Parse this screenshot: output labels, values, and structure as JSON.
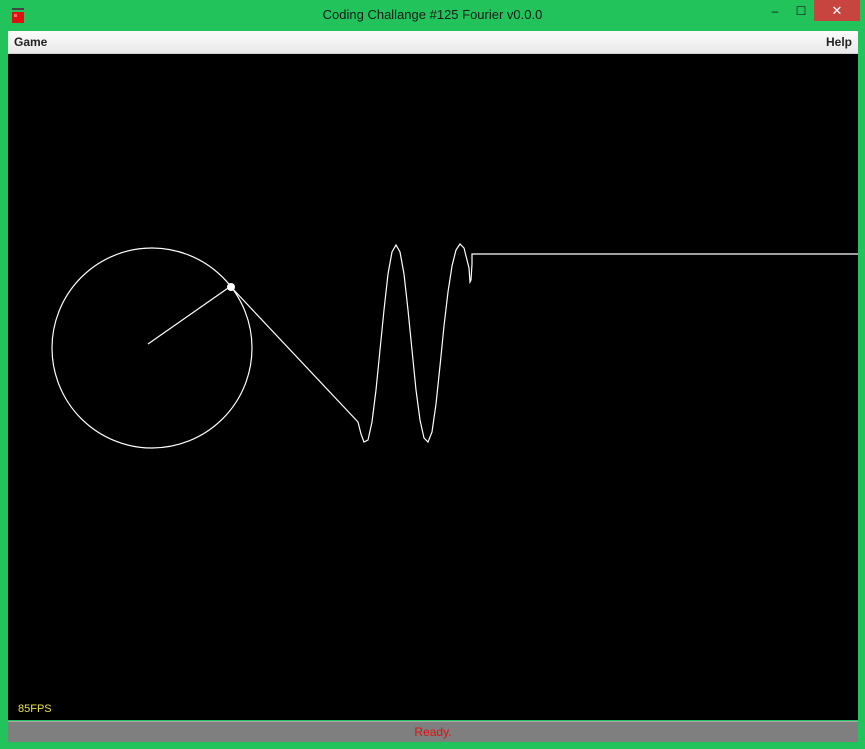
{
  "window": {
    "title": "Coding Challange #125 Fourier v0.0.0",
    "minimize_glyph": "–",
    "maximize_glyph": "☐",
    "close_glyph": "✕"
  },
  "menu": {
    "left": "Game",
    "right": "Help"
  },
  "hud": {
    "fps": "85FPS"
  },
  "status": {
    "text": "Ready."
  },
  "colors": {
    "frame": "#23c35b",
    "canvas": "#000000",
    "stroke": "#ffffff",
    "fps": "#e5e14a",
    "status_text": "#e01010",
    "status_bar": "#7f7f7f"
  }
}
